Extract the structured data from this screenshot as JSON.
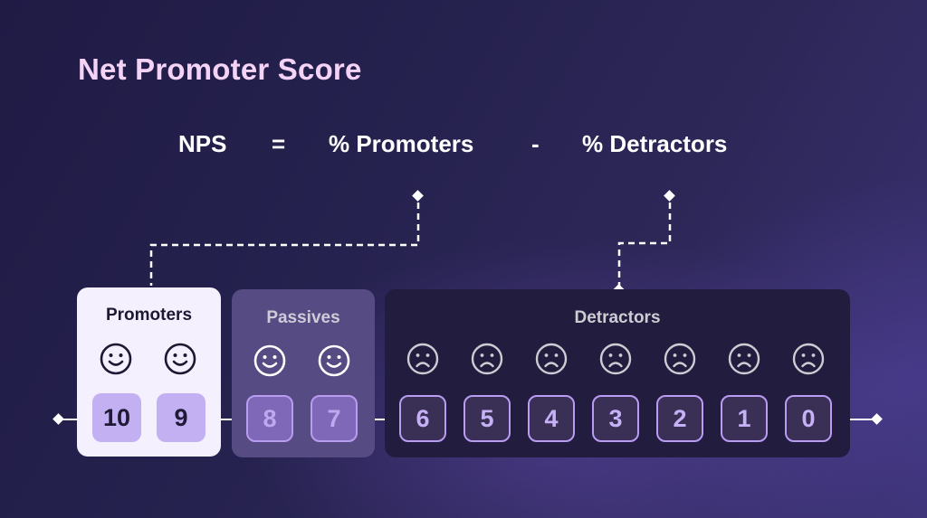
{
  "title": "Net Promoter Score",
  "formula": {
    "lhs": "NPS",
    "equals": "=",
    "term1": "% Promoters",
    "operator": "-",
    "term2": "% Detractors"
  },
  "groups": [
    {
      "label": "Promoters",
      "sentiment": "happy",
      "icon": "smiley-face-icon",
      "scores": [
        "10",
        "9"
      ],
      "color": "#f4f0fd"
    },
    {
      "label": "Passives",
      "sentiment": "happy",
      "icon": "smiley-face-icon",
      "scores": [
        "8",
        "7"
      ],
      "color": "#564b83"
    },
    {
      "label": "Detractors",
      "sentiment": "sad",
      "icon": "frowning-face-icon",
      "scores": [
        "6",
        "5",
        "4",
        "3",
        "2",
        "1",
        "0"
      ],
      "color": "#221c3f"
    }
  ],
  "colors": {
    "title": "#f4d3f6",
    "text": "#ffffff",
    "accent": "#c3b0f2",
    "accent_border": "#b99cf3"
  }
}
